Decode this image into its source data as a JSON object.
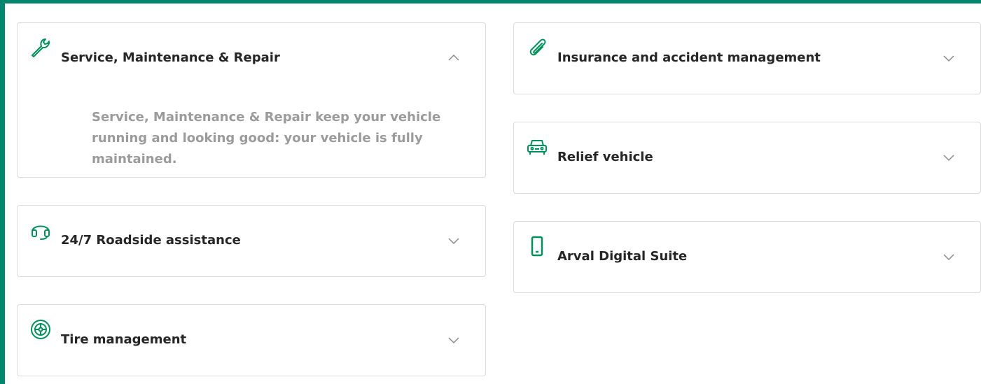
{
  "theme": {
    "accent": "#00915a",
    "frame_border": "#00856f",
    "title_color": "#262626",
    "muted_text": "#9b9b9b",
    "chevron_color": "#8a8a8a"
  },
  "accordion": {
    "left": [
      {
        "title": "Service, Maintenance & Repair",
        "icon": "wrench-icon",
        "expanded": true,
        "body": "Service, Maintenance & Repair keep your vehicle running and looking good: your vehicle is fully maintained."
      },
      {
        "title": "24/7 Roadside assistance",
        "icon": "headset-icon",
        "expanded": false
      },
      {
        "title": "Tire management",
        "icon": "tire-icon",
        "expanded": false
      }
    ],
    "right": [
      {
        "title": "Insurance and accident management",
        "icon": "paperclip-icon",
        "expanded": false
      },
      {
        "title": "Relief vehicle",
        "icon": "car-icon",
        "expanded": false
      },
      {
        "title": "Arval Digital Suite",
        "icon": "smartphone-icon",
        "expanded": false
      }
    ]
  }
}
